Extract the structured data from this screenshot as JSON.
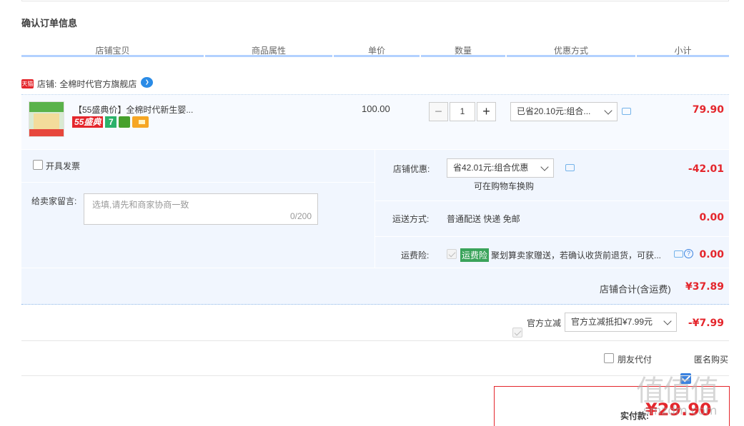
{
  "page_title": "确认订单信息",
  "columns": [
    "店铺宝贝",
    "商品属性",
    "单价",
    "数量",
    "优惠方式",
    "小计"
  ],
  "shop": {
    "badge": "天猫",
    "label": "店铺:",
    "name": "全棉时代官方旗舰店"
  },
  "item": {
    "name": "【55盛典价】全棉时代新生婴...",
    "badge_promo": "55盛典",
    "badge_seven": "7",
    "unit_price": "100.00",
    "quantity": "1",
    "minus": "−",
    "plus": "+",
    "discount_select": "已省20.10元:组合...",
    "subtotal": "79.90"
  },
  "invoice": {
    "label": "开具发票"
  },
  "message": {
    "label": "给卖家留言:",
    "placeholder": "选填,请先和商家协商一致",
    "counter": "0/200"
  },
  "shop_discount": {
    "label": "店铺优惠:",
    "select": "省42.01元:组合优惠",
    "note": "可在购物车换购",
    "amount": "-42.01"
  },
  "shipping": {
    "label": "运送方式:",
    "value": "普通配送 快递 免邮",
    "amount": "0.00"
  },
  "insurance": {
    "label": "运费险:",
    "tag": "运费险",
    "text": "聚划算卖家赠送，若确认收货前退货，可获...",
    "amount": "0.00"
  },
  "shop_total": {
    "label": "店铺合计(含运费)",
    "amount": "¥37.89"
  },
  "official_discount": {
    "label": "官方立减",
    "select": "官方立减抵扣¥7.99元",
    "amount": "-¥7.99"
  },
  "options": {
    "friend_pay": "朋友代付",
    "anonymous": "匿名购买"
  },
  "payment": {
    "label": "实付款:",
    "amount": "¥29.90"
  },
  "watermark": {
    "logo": "值值值",
    "site": "smzdm.com"
  },
  "colors": {
    "accent_red": "#e4262c",
    "header_line": "#b2d1ff",
    "panel_bg": "#f1f6fe",
    "check_blue": "#3a82e0"
  }
}
